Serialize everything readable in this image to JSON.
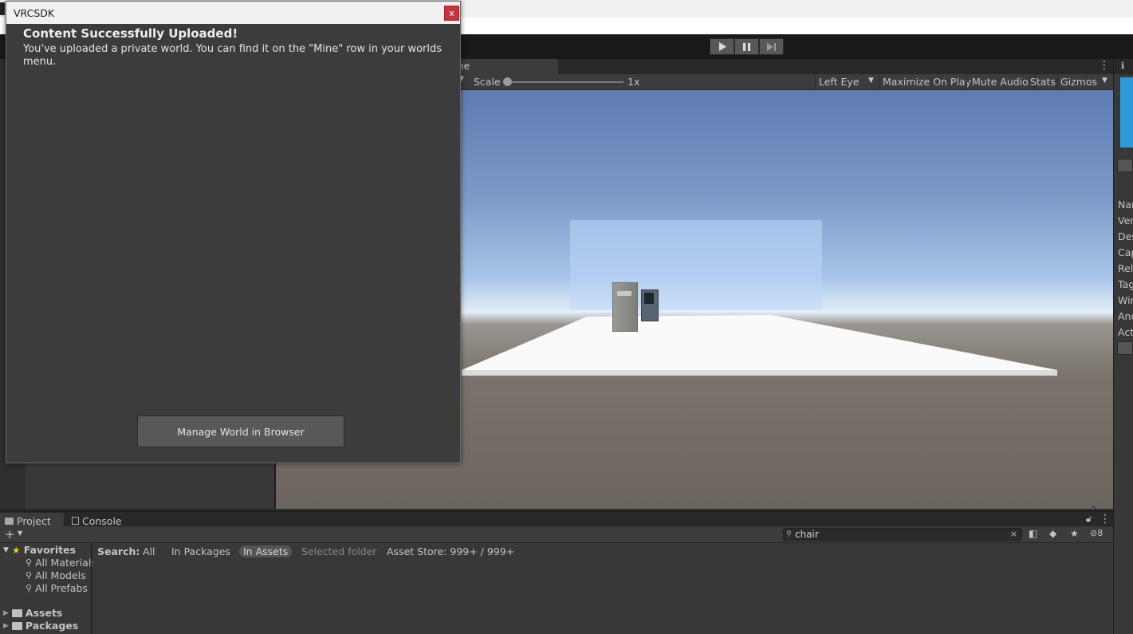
{
  "dialog": {
    "title": "VRCSDK",
    "close_label": "x",
    "heading": "Content Successfully Uploaded!",
    "body": "You've uploaded a private world. You can find it on the \"Mine\" row in your worlds menu.",
    "button": "Manage World in Browser"
  },
  "game_view": {
    "tab_label": "ne",
    "scale_label": "Scale",
    "scale_value": "1x",
    "scale_level": 0.0,
    "eye_select": "Left Eye",
    "maximize": "Maximize On Play",
    "mute": "Mute Audio",
    "stats": "Stats",
    "gizmos": "Gizmos"
  },
  "inspector": {
    "labels": [
      "Nar",
      "Ver",
      "Des",
      "Cap",
      "Rel",
      "Tag",
      "Win",
      "And",
      "Act"
    ]
  },
  "project": {
    "tabs": [
      {
        "label": "Project",
        "icon": "folder-icon"
      },
      {
        "label": "Console",
        "icon": "console-icon"
      }
    ],
    "search_value": "chair",
    "hidden_count": "8",
    "favorites": {
      "label": "Favorites",
      "items": [
        "All Materials",
        "All Models",
        "All Prefabs"
      ]
    },
    "roots": [
      "Assets",
      "Packages"
    ],
    "search_label": "Search:",
    "filters": [
      "All",
      "In Packages",
      "In Assets",
      "Selected folder"
    ],
    "asset_store": "Asset Store: 999+ / 999+"
  },
  "colors": {
    "accent_close": "#c6343f",
    "inspector_thumb": "#2e9bd6",
    "favorite_star": "#f0c419"
  }
}
